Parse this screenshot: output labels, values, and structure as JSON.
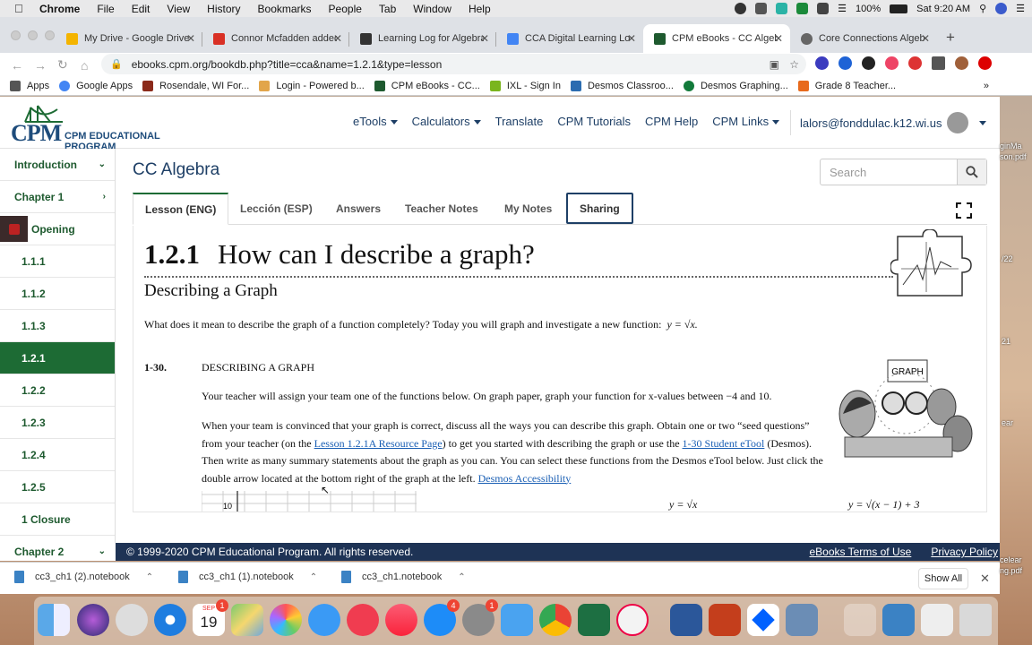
{
  "menubar": {
    "app": "Chrome",
    "items": [
      "File",
      "Edit",
      "View",
      "History",
      "Bookmarks",
      "People",
      "Tab",
      "Window",
      "Help"
    ],
    "battery": "100%",
    "clock": "Sat 9:20 AM"
  },
  "tabs": [
    {
      "title": "My Drive - Google Drive",
      "color": "#f4b400"
    },
    {
      "title": "Connor Mcfadden added",
      "color": "#d93025"
    },
    {
      "title": "Learning Log for Algebra",
      "color": "#333333"
    },
    {
      "title": "CCA Digital Learning Log",
      "color": "#4285f4"
    },
    {
      "title": "CPM eBooks - CC Algebra",
      "color": "#1e5a2f"
    },
    {
      "title": "Core Connections Algebra",
      "color": "#666666"
    }
  ],
  "url": "ebooks.cpm.org/bookdb.php?title=cca&name=1.2.1&type=lesson",
  "bookmarks": [
    {
      "label": "Apps",
      "color": "#555555"
    },
    {
      "label": "Google Apps",
      "color": "#4285f4"
    },
    {
      "label": "Rosendale, WI For...",
      "color": "#8b2a1a"
    },
    {
      "label": "Login - Powered b...",
      "color": "#e2a54a"
    },
    {
      "label": "CPM eBooks - CC...",
      "color": "#1e5a2f"
    },
    {
      "label": "IXL - Sign In",
      "color": "#7ab51d"
    },
    {
      "label": "Desmos Classroo...",
      "color": "#2b6cb0"
    },
    {
      "label": "Desmos Graphing...",
      "color": "#127a3a"
    },
    {
      "label": "Grade 8 Teacher...",
      "color": "#e86a1c"
    }
  ],
  "cpm": {
    "logo_main": "CPM",
    "logo_sub": "CPM EDUCATIONAL PROGRAM",
    "nav": [
      {
        "label": "eTools",
        "dropdown": true
      },
      {
        "label": "Calculators",
        "dropdown": true
      },
      {
        "label": "Translate",
        "dropdown": false
      },
      {
        "label": "CPM Tutorials",
        "dropdown": false
      },
      {
        "label": "CPM Help",
        "dropdown": false
      },
      {
        "label": "CPM Links",
        "dropdown": true
      }
    ],
    "user": "lalors@fonddulac.k12.wi.us"
  },
  "sidebar": [
    {
      "label": "Introduction",
      "icon": "chevron-down"
    },
    {
      "label": "Chapter 1",
      "icon": "chevron-right"
    },
    {
      "label": "Opening"
    },
    {
      "label": "1.1.1"
    },
    {
      "label": "1.1.2"
    },
    {
      "label": "1.1.3"
    },
    {
      "label": "1.2.1",
      "active": true
    },
    {
      "label": "1.2.2"
    },
    {
      "label": "1.2.3"
    },
    {
      "label": "1.2.4"
    },
    {
      "label": "1.2.5"
    },
    {
      "label": "1 Closure"
    },
    {
      "label": "Chapter 2",
      "icon": "chevron-down"
    }
  ],
  "book_title": "CC Algebra",
  "search_placeholder": "Search",
  "lesson_tabs": [
    "Lesson (ENG)",
    "Lección (ESP)",
    "Answers",
    "Teacher Notes",
    "My Notes",
    "Sharing"
  ],
  "lesson": {
    "number": "1.2.1",
    "title": "How can I describe a graph?",
    "subtitle": "Describing a Graph",
    "intro": "What does it mean to describe the graph of a function completely?  Today you will graph and investigate a new function:",
    "intro_eq": "y = √x.",
    "problem_number": "1-30.",
    "problem_heading": "DESCRIBING A GRAPH",
    "p1": "Your teacher will assign your team one of the functions below.  On graph paper, graph your function for x-values between −4 and 10.",
    "p2a": "When your team is convinced that your graph is correct, discuss all the ways you can describe this graph.  Obtain one or two “seed questions” from your teacher (on the ",
    "link1": "Lesson 1.2.1A Resource Page",
    "p2b": ") to get you started with describing the graph or use the ",
    "link2": "1-30 Student eTool",
    "p2c": " (Desmos).  Then write as many summary statements about the graph as you can.  You can select these functions from the Desmos eTool below. Just click the double arrow located at the bottom right of the graph at the left.  ",
    "link3": "Desmos Accessibility",
    "eq1": "y = √x",
    "eq2": "y = √(x − 1) + 3",
    "graph_tick": "10",
    "graph_sign": "GRAPH"
  },
  "footer": {
    "copyright": "© 1999-2020 CPM Educational Program. All rights reserved.",
    "links": [
      "eBooks Terms of Use",
      "Privacy Policy"
    ]
  },
  "downloads": [
    "cc3_ch1 (2).notebook",
    "cc3_ch1 (1).notebook",
    "cc3_ch1.notebook"
  ],
  "show_all": "Show All",
  "dock": {
    "calendar_month": "SEP",
    "calendar_day": "19",
    "badges": {
      "calendar": "1",
      "appstore": "4",
      "settings": "1"
    }
  },
  "desktop_labels": [
    "ginMa",
    "son.pdf",
    "/22",
    "21",
    "ear",
    "celear",
    "ng.pdf"
  ]
}
